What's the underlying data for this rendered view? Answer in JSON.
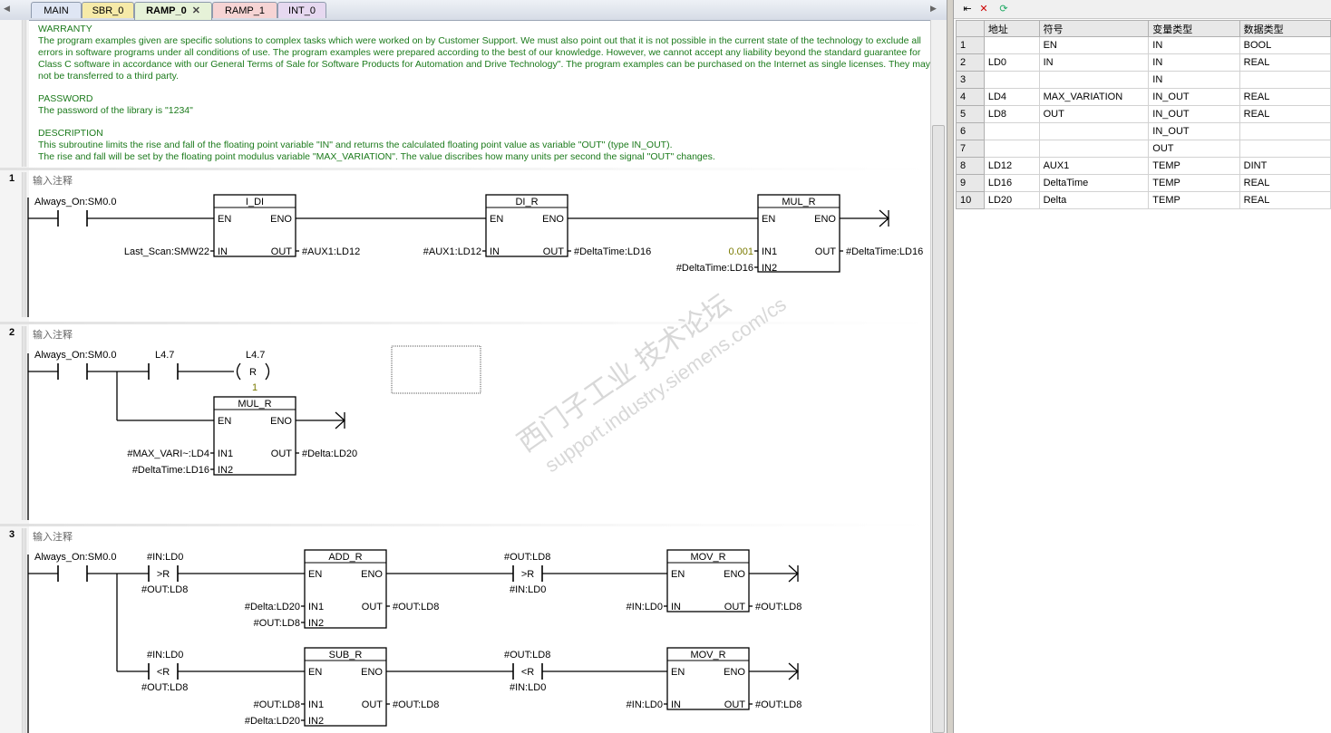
{
  "tabs": [
    {
      "label": "MAIN",
      "bg": "#dfe6f4"
    },
    {
      "label": "SBR_0",
      "bg": "#f6eaa8"
    },
    {
      "label": "RAMP_0",
      "bg": "#e6f2d8",
      "active": true
    },
    {
      "label": "RAMP_1",
      "bg": "#f6d4d4"
    },
    {
      "label": "INT_0",
      "bg": "#e6d8f0"
    }
  ],
  "warranty": {
    "h1": "WARRANTY",
    "p1": "The program examples given are specific solutions to complex tasks which were worked on by Customer Support. We must also point out that it is not possible in the current state of the technology to exclude all errors in software programs under all conditions of use. The program examples were prepared according to the best of our knowledge. However, we cannot accept any liability beyond the standard guarantee for Class C software in accordance with our General Terms of Sale for Software Products for Automation and Drive Technology\". The program examples can be purchased on the Internet as single licenses. They may not be transferred to a third party.",
    "h2": "PASSWORD",
    "p2": "The password of the library is \"1234\"",
    "h3": "DESCRIPTION",
    "p3": "This subroutine limits the rise and fall of the floating point variable \"IN\" and returns the calculated floating point value as variable \"OUT\" (type IN_OUT).",
    "p4": "The rise and fall will be set by the floating point modulus variable \"MAX_VARIATION\". The value discribes how many units per second the signal \"OUT\" changes."
  },
  "network_comment": "输入注释",
  "networks": {
    "n1": "1",
    "n2": "2",
    "n3": "3"
  },
  "ladder": {
    "always_on": "Always_On:SM0.0",
    "en": "EN",
    "eno": "ENO",
    "in": "IN",
    "out": "OUT",
    "in1": "IN1",
    "in2": "IN2",
    "n1_b1_title": "I_DI",
    "n1_b1_in": "Last_Scan:SMW22",
    "n1_b1_out": "#AUX1:LD12",
    "n1_b2_title": "DI_R",
    "n1_b2_in": "#AUX1:LD12",
    "n1_b2_out": "#DeltaTime:LD16",
    "n1_b3_title": "MUL_R",
    "n1_b3_in1": "0.001",
    "n1_b3_in2": "#DeltaTime:LD16",
    "n1_b3_out": "#DeltaTime:LD16",
    "n2_contact": "L4.7",
    "n2_coil": "L4.7",
    "n2_coil_type": "R",
    "n2_coil_n": "1",
    "n2_b1_title": "MUL_R",
    "n2_b1_in1": "#MAX_VARI~:LD4",
    "n2_b1_in2": "#DeltaTime:LD16",
    "n2_b1_out": "#Delta:LD20",
    "n3_c1_top": "#IN:LD0",
    "n3_c1_op": ">R",
    "n3_c1_bot": "#OUT:LD8",
    "n3_b1_title": "ADD_R",
    "n3_b1_in1": "#Delta:LD20",
    "n3_b1_in2": "#OUT:LD8",
    "n3_b1_out": "#OUT:LD8",
    "n3_c2_top": "#OUT:LD8",
    "n3_c2_op": ">R",
    "n3_c2_bot": "#IN:LD0",
    "n3_b2_title": "MOV_R",
    "n3_b2_in": "#IN:LD0",
    "n3_b2_out": "#OUT:LD8",
    "n3_c3_top": "#IN:LD0",
    "n3_c3_op": "<R",
    "n3_c3_bot": "#OUT:LD8",
    "n3_b3_title": "SUB_R",
    "n3_b3_in1": "#OUT:LD8",
    "n3_b3_in2": "#Delta:LD20",
    "n3_b3_out": "#OUT:LD8",
    "n3_c4_top": "#OUT:LD8",
    "n3_c4_op": "<R",
    "n3_c4_bot": "#IN:LD0",
    "n3_b4_title": "MOV_R",
    "n3_b4_in": "#IN:LD0",
    "n3_b4_out": "#OUT:LD8"
  },
  "watermark": {
    "line1": "西门子工业 技术论坛",
    "line2": "support.industry.siemens.com/cs"
  },
  "var_table": {
    "headers": [
      "地址",
      "符号",
      "变量类型",
      "数据类型"
    ],
    "rows": [
      [
        "1",
        "",
        "EN",
        "IN",
        "BOOL"
      ],
      [
        "2",
        "LD0",
        "IN",
        "IN",
        "REAL"
      ],
      [
        "3",
        "",
        "",
        "IN",
        ""
      ],
      [
        "4",
        "LD4",
        "MAX_VARIATION",
        "IN_OUT",
        "REAL"
      ],
      [
        "5",
        "LD8",
        "OUT",
        "IN_OUT",
        "REAL"
      ],
      [
        "6",
        "",
        "",
        "IN_OUT",
        ""
      ],
      [
        "7",
        "",
        "",
        "OUT",
        ""
      ],
      [
        "8",
        "LD12",
        "AUX1",
        "TEMP",
        "DINT"
      ],
      [
        "9",
        "LD16",
        "DeltaTime",
        "TEMP",
        "REAL"
      ],
      [
        "10",
        "LD20",
        "Delta",
        "TEMP",
        "REAL"
      ]
    ]
  },
  "colors": {
    "comment_green": "#1b7a1b",
    "constant_olive": "#7a7a00"
  }
}
